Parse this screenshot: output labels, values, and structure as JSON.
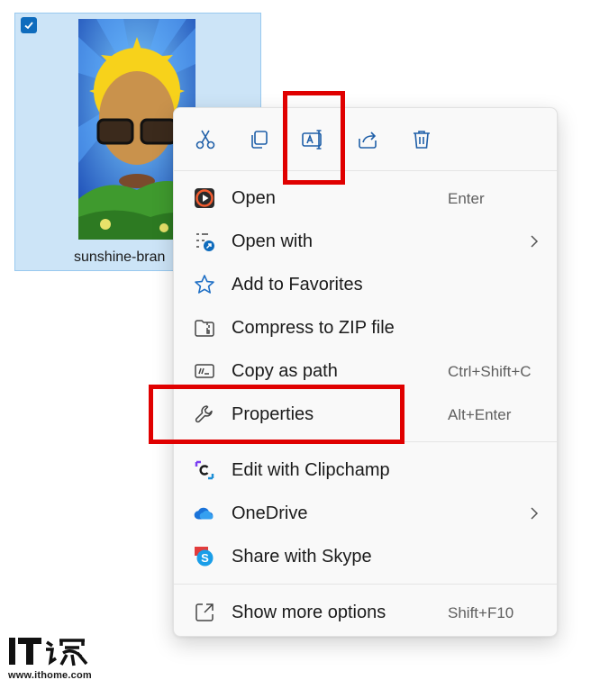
{
  "file": {
    "name": "sunshine-bran",
    "selected": true
  },
  "toolbar": {
    "buttons": [
      {
        "name": "cut",
        "icon": "scissors-icon"
      },
      {
        "name": "copy",
        "icon": "copy-icon"
      },
      {
        "name": "rename",
        "icon": "rename-icon"
      },
      {
        "name": "share",
        "icon": "share-icon"
      },
      {
        "name": "delete",
        "icon": "trash-icon"
      }
    ]
  },
  "menu": {
    "items": [
      {
        "label": "Open",
        "shortcut": "Enter",
        "icon": "media-player-icon"
      },
      {
        "label": "Open with",
        "shortcut": "",
        "icon": "open-with-icon",
        "submenu": true
      },
      {
        "label": "Add to Favorites",
        "shortcut": "",
        "icon": "star-icon"
      },
      {
        "label": "Compress to ZIP file",
        "shortcut": "",
        "icon": "zip-icon"
      },
      {
        "label": "Copy as path",
        "shortcut": "Ctrl+Shift+C",
        "icon": "copy-path-icon"
      },
      {
        "label": "Properties",
        "shortcut": "Alt+Enter",
        "icon": "wrench-icon"
      },
      {
        "label": "Edit with Clipchamp",
        "shortcut": "",
        "icon": "clipchamp-icon"
      },
      {
        "label": "OneDrive",
        "shortcut": "",
        "icon": "cloud-icon",
        "submenu": true
      },
      {
        "label": "Share with Skype",
        "shortcut": "",
        "icon": "skype-icon"
      },
      {
        "label": "Show more options",
        "shortcut": "Shift+F10",
        "icon": "show-more-icon"
      }
    ]
  },
  "watermark": {
    "logo_text": "IT之家",
    "url": "www.ithome.com"
  },
  "colors": {
    "accent": "#0f6cbd",
    "highlight": "#e00000",
    "selection": "#cce4f7"
  }
}
